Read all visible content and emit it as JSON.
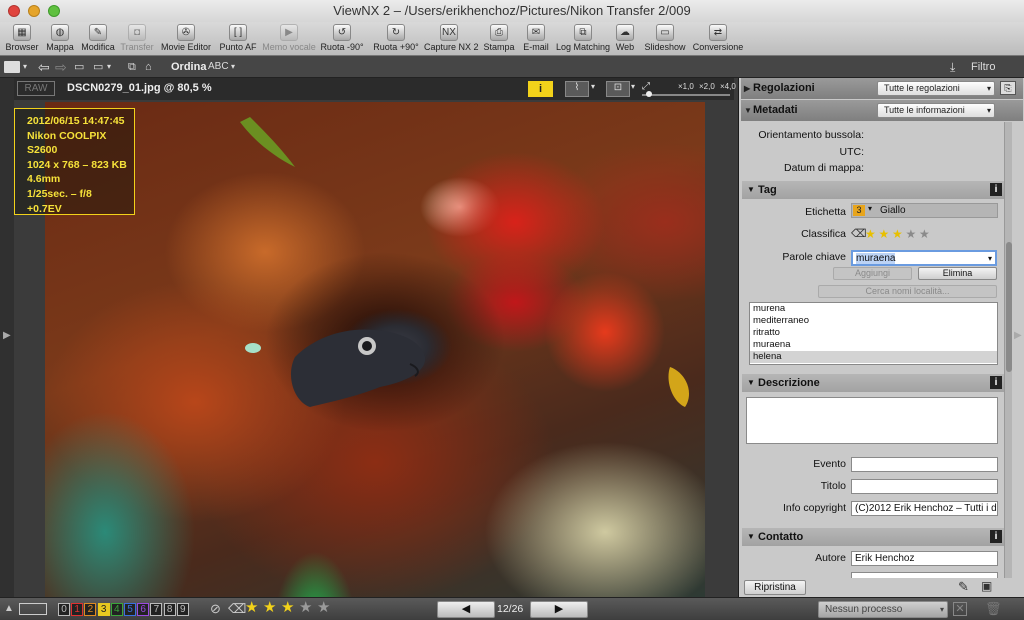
{
  "window": {
    "title": "ViewNX 2 – /Users/erikhenchoz/Pictures/Nikon Transfer 2/009"
  },
  "toolbar": {
    "items": [
      {
        "label": "Browser",
        "icon": "browser-icon",
        "enabled": true
      },
      {
        "label": "Mappa",
        "icon": "globe-icon",
        "enabled": true
      },
      {
        "label": "Modifica",
        "icon": "edit-icon",
        "enabled": true
      },
      {
        "label": "Transfer",
        "icon": "camera-icon",
        "enabled": false
      },
      {
        "label": "Movie Editor",
        "icon": "film-reel-icon",
        "enabled": true
      },
      {
        "label": "Punto AF",
        "icon": "af-point-icon",
        "enabled": true
      },
      {
        "label": "Memo vocale",
        "icon": "play-icon",
        "enabled": false
      },
      {
        "label": "Ruota -90°",
        "icon": "rotate-left-icon",
        "enabled": true
      },
      {
        "label": "Ruota +90°",
        "icon": "rotate-right-icon",
        "enabled": true
      },
      {
        "label": "Capture NX 2",
        "icon": "capture-nx-icon",
        "enabled": true
      },
      {
        "label": "Stampa",
        "icon": "printer-icon",
        "enabled": true
      },
      {
        "label": "E-mail",
        "icon": "mail-icon",
        "enabled": true
      },
      {
        "label": "Log Matching",
        "icon": "log-matching-icon",
        "enabled": true
      },
      {
        "label": "Web",
        "icon": "web-icon",
        "enabled": true
      },
      {
        "label": "Slideshow",
        "icon": "slideshow-icon",
        "enabled": true
      },
      {
        "label": "Conversione",
        "icon": "convert-icon",
        "enabled": true
      }
    ]
  },
  "bar2": {
    "sort_label": "Ordina",
    "sort_value": "ABC",
    "filter_label": "Filtro"
  },
  "viewer": {
    "raw_badge": "RAW",
    "file_title": "DSCN0279_01.jpg @ 80,5 %",
    "info_badge": "i",
    "zoom_labels": [
      "×1,0",
      "×2,0",
      "×4,0"
    ],
    "exif": {
      "datetime": "2012/06/15 14:47:45",
      "camera": "Nikon COOLPIX S2600",
      "dimensions": "1024 x 768 – 823 KB",
      "focal": "4.6mm",
      "exposure": "1/25sec. – f/8",
      "ev": "+0.7EV"
    }
  },
  "panel": {
    "regolazioni": {
      "title": "Regolazioni",
      "dropdown": "Tutte le regolazioni"
    },
    "metadati": {
      "title": "Metadati",
      "dropdown": "Tutte le informazioni"
    },
    "gps": {
      "orientamento": "Orientamento bussola:",
      "utc": "UTC:",
      "datum": "Datum di mappa:"
    },
    "tag": {
      "title": "Tag",
      "etichetta_label": "Etichetta",
      "etichetta_num": "3",
      "etichetta_value": "Giallo",
      "classifica_label": "Classifica",
      "rating": 3,
      "rating_max": 5,
      "parole_label": "Parole chiave",
      "parole_value": "muraena",
      "aggiungi": "Aggiungi",
      "elimina": "Elimina",
      "cerca": "Cerca nomi località...",
      "keywords": [
        "murena",
        "mediterraneo",
        "ritratto",
        "muraena",
        "helena"
      ],
      "selected_keyword": "helena"
    },
    "descrizione": {
      "title": "Descrizione",
      "evento_label": "Evento",
      "titolo_label": "Titolo",
      "copyright_label": "Info copyright",
      "copyright_value": "(C)2012 Erik Henchoz – Tutti i dir"
    },
    "contatto": {
      "title": "Contatto",
      "autore_label": "Autore",
      "autore_value": "Erik Henchoz"
    },
    "ripristina": "Ripristina"
  },
  "bottom": {
    "labels": [
      "0",
      "1",
      "2",
      "3",
      "4",
      "5",
      "6",
      "7",
      "8",
      "9"
    ],
    "label_colors": [
      "#bbbbbb",
      "#e03030",
      "#e08a20",
      "#e8c820",
      "#3aa63a",
      "#3a70e0",
      "#9a4ae0",
      "#bbbbbb",
      "#bbbbbb",
      "#bbbbbb"
    ],
    "rating": 3,
    "rating_max": 5,
    "page": "12/26",
    "process": "Nessun processo"
  }
}
